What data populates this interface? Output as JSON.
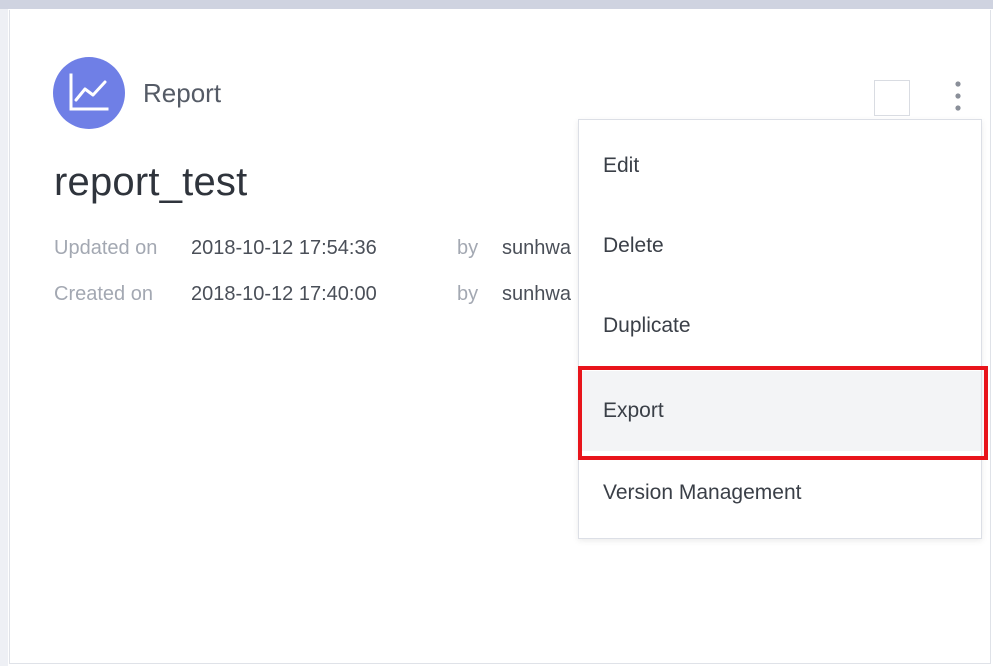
{
  "card": {
    "type_label": "Report",
    "type_icon": "line-chart-icon",
    "title": "report_test",
    "updated": {
      "label": "Updated on",
      "date": "2018-10-12 17:54:36",
      "by": "by",
      "user": "sunhwa"
    },
    "created": {
      "label": "Created on",
      "date": "2018-10-12 17:40:00",
      "by": "by",
      "user": "sunhwa"
    }
  },
  "menu": {
    "items": [
      {
        "label": "Edit"
      },
      {
        "label": "Delete"
      },
      {
        "label": "Duplicate"
      },
      {
        "label": "Export"
      },
      {
        "label": "Version Management"
      }
    ],
    "highlighted_item": "Export"
  },
  "colors": {
    "icon_bg": "#6f7fe6",
    "highlight": "#e8141b"
  }
}
